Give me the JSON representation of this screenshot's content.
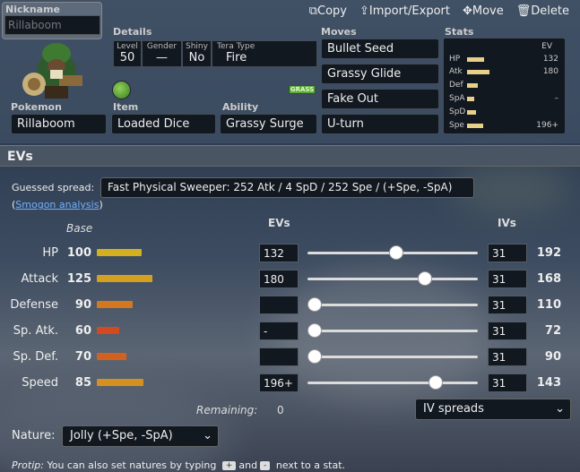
{
  "actions": {
    "copy": "Copy",
    "import_export": "Import/Export",
    "move": "Move",
    "delete": "Delete"
  },
  "nickname": {
    "label": "Nickname",
    "placeholder": "Rillaboom"
  },
  "details": {
    "label": "Details",
    "level_h": "Level",
    "level": "50",
    "gender_h": "Gender",
    "gender": "—",
    "shiny_h": "Shiny",
    "shiny": "No",
    "tera_h": "Tera Type",
    "tera": "Fire"
  },
  "type_badge": "GRASS",
  "pokemon": {
    "label": "Pokemon",
    "value": "Rillaboom"
  },
  "item": {
    "label": "Item",
    "value": "Loaded Dice"
  },
  "ability": {
    "label": "Ability",
    "value": "Grassy Surge"
  },
  "moves": {
    "label": "Moves",
    "list": [
      "Bullet Seed",
      "Grassy Glide",
      "Fake Out",
      "U-turn"
    ]
  },
  "stats_panel": {
    "label": "Stats",
    "ev_h": "EV",
    "rows": [
      {
        "n": "HP",
        "bar": 0.35,
        "ev": "132"
      },
      {
        "n": "Atk",
        "bar": 0.45,
        "ev": "180"
      },
      {
        "n": "Def",
        "bar": 0.25,
        "ev": ""
      },
      {
        "n": "SpA",
        "bar": 0.15,
        "ev": "–"
      },
      {
        "n": "SpD",
        "bar": 0.2,
        "ev": ""
      },
      {
        "n": "Spe",
        "bar": 0.3,
        "ev": "196+"
      }
    ]
  },
  "evs_title": "EVs",
  "guessed": {
    "label": "Guessed spread:",
    "value": "Fast Physical Sweeper: 252 Atk / 4 SpD / 252 Spe / (+Spe, -SpA)"
  },
  "smogon": {
    "open": "(",
    "link": "Smogon analysis",
    "close": ")"
  },
  "cols": {
    "base": "Base",
    "evs": "EVs",
    "ivs": "IVs"
  },
  "stats": [
    {
      "name": "HP",
      "base": "100",
      "bar": 0.5,
      "color": "#d4b020",
      "ev": "132",
      "slider": 0.52,
      "iv": "31",
      "total": "192"
    },
    {
      "name": "Attack",
      "base": "125",
      "bar": 0.62,
      "color": "#d4a020",
      "ev": "180",
      "slider": 0.69,
      "iv": "31",
      "total": "168"
    },
    {
      "name": "Defense",
      "base": "90",
      "bar": 0.4,
      "color": "#d47820",
      "ev": "",
      "slider": 0.04,
      "iv": "31",
      "total": "110"
    },
    {
      "name": "Sp. Atk.",
      "base": "60",
      "bar": 0.25,
      "color": "#d44a20",
      "ev": "-",
      "slider": 0.04,
      "iv": "31",
      "total": "72"
    },
    {
      "name": "Sp. Def.",
      "base": "70",
      "bar": 0.33,
      "color": "#d46020",
      "ev": "",
      "slider": 0.04,
      "iv": "31",
      "total": "90"
    },
    {
      "name": "Speed",
      "base": "85",
      "bar": 0.52,
      "color": "#d49020",
      "ev": "196+",
      "slider": 0.75,
      "iv": "31",
      "total": "143"
    }
  ],
  "remaining": {
    "label": "Remaining:",
    "value": "0"
  },
  "iv_spreads": "IV spreads",
  "nature": {
    "label": "Nature:",
    "value": "Jolly (+Spe, -SpA)"
  },
  "protip": {
    "prefix": "Protip:",
    "text1": "You can also set natures by typing",
    "k1": "+",
    "and": "and",
    "k2": "-",
    "text2": "next to a stat."
  }
}
